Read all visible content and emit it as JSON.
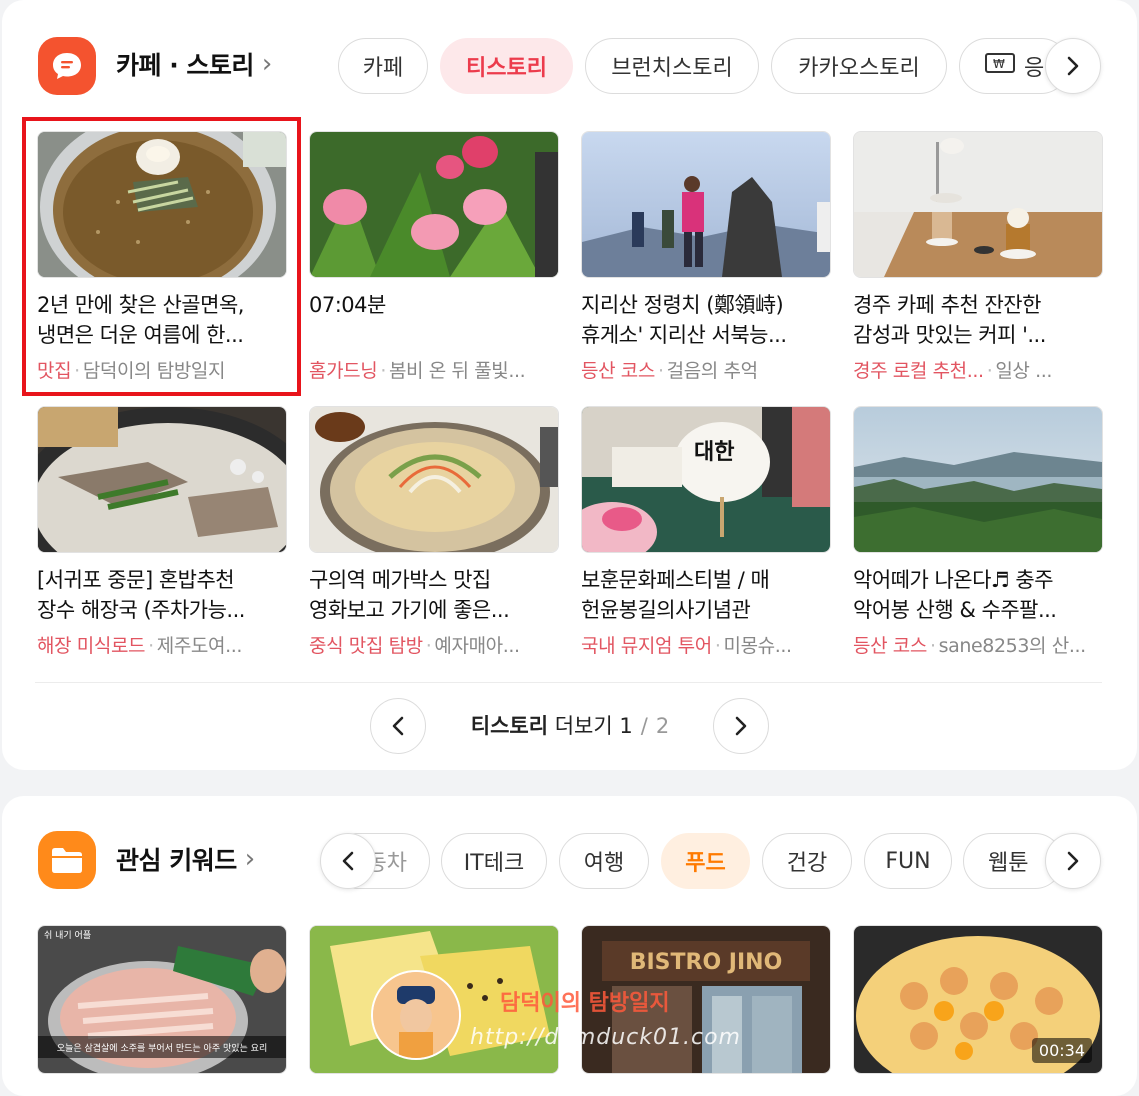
{
  "section1": {
    "title": "카페 · 스토리",
    "chevron": "›",
    "tabs": [
      "카페",
      "티스토리",
      "브런치스토리",
      "카카오스토리",
      "응"
    ],
    "cards": [
      {
        "title1": "2년 만에 찾은 산골면옥,",
        "title2": "냉면은 더운 여름에 한...",
        "category": "맛집",
        "source": "담덕이의 탐방일지"
      },
      {
        "title1": "07:04분",
        "title2": "",
        "category": "홈가드닝",
        "source": "봄비 온 뒤 풀빛..."
      },
      {
        "title1": "지리산 정령치 (鄭領峙)",
        "title2": "휴게소' 지리산 서북능...",
        "category": "등산 코스",
        "source": "걸음의 추억"
      },
      {
        "title1": "경주 카페 추천 잔잔한",
        "title2": "감성과 맛있는 커피 '...",
        "category": "경주 로컬 추천...",
        "source": "일상 ..."
      },
      {
        "title1": "[서귀포 중문] 혼밥추천",
        "title2": "장수 해장국 (주차가능...",
        "category": "해장 미식로드",
        "source": "제주도여..."
      },
      {
        "title1": "구의역 메가박스 맛집",
        "title2": "영화보고 가기에 좋은...",
        "category": "중식 맛집 탐방",
        "source": "예자매아..."
      },
      {
        "title1": "보훈문화페스티벌 / 매",
        "title2": "헌윤봉길의사기념관",
        "category": "국내 뮤지엄 투어",
        "source": "미몽슈..."
      },
      {
        "title1": "악어떼가 나온다♬ 충주",
        "title2": "악어봉 산행 & 수주팔...",
        "category": "등산 코스",
        "source": "sane8253의 산..."
      }
    ],
    "pager": {
      "label": "티스토리",
      "more": "더보기",
      "current": "1",
      "sep": "/",
      "total": "2"
    }
  },
  "section2": {
    "title": "관심 키워드",
    "chevron": "›",
    "tabs": [
      "동차",
      "IT테크",
      "여행",
      "푸드",
      "건강",
      "FUN",
      "웹툰"
    ],
    "thumb1_caption": "오늘은 삼겹살에 소주를 부어서 만드는 아주 맛있는 요리",
    "thumb1_label": "쉬 내기 어플",
    "thumb3_sign": "BISTRO JINO",
    "duration": "00:34",
    "watermark": "담덕이의 탐방일지",
    "watermark_url": "http://damduck01.com"
  },
  "colors": {
    "accent_pink": "#ec3b4c",
    "accent_orange": "#ff7a00",
    "highlight": "#e8141b"
  }
}
